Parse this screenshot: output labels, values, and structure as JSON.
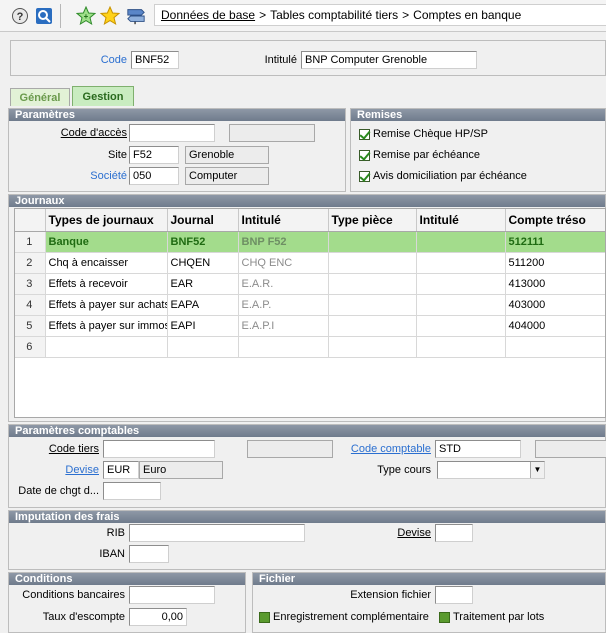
{
  "toolbar": {
    "icons": [
      "help-icon",
      "search-icon",
      "favorite-add-icon",
      "favorite-star-icon",
      "signpost-icon"
    ]
  },
  "breadcrumb": {
    "items": [
      "Données de base",
      "Tables comptabilité tiers",
      "Comptes en banque"
    ]
  },
  "header": {
    "code_label": "Code",
    "code_value": "BNF52",
    "intitule_label": "Intitulé",
    "intitule_value": "BNP Computer Grenoble"
  },
  "tabs": [
    {
      "label": "Général",
      "active": false
    },
    {
      "label": "Gestion",
      "active": true
    }
  ],
  "parametres": {
    "title": "Paramètres",
    "code_acces_label": "Code d'accès",
    "code_acces_value": "",
    "code_acces_extra": "",
    "site_label": "Site",
    "site_code": "F52",
    "site_name": "Grenoble",
    "societe_label": "Société",
    "societe_code": "050",
    "societe_name": "Computer"
  },
  "remises": {
    "title": "Remises",
    "items": [
      {
        "label": "Remise Chèque HP/SP",
        "checked": true
      },
      {
        "label": "Remise par échéance",
        "checked": true
      },
      {
        "label": "Avis domiciliation par échéance",
        "checked": true
      }
    ]
  },
  "journaux": {
    "title": "Journaux",
    "columns": [
      "Types de journaux",
      "Journal",
      "Intitulé",
      "Type pièce",
      "Intitulé",
      "Compte tréso"
    ],
    "rows": [
      {
        "idx": "1",
        "type": "Banque",
        "journal": "BNF52",
        "intitule": "BNP F52",
        "type_piece": "",
        "intitule2": "",
        "compte": "512111"
      },
      {
        "idx": "2",
        "type": "Chq à encaisser",
        "journal": "CHQEN",
        "intitule": "CHQ ENC",
        "type_piece": "",
        "intitule2": "",
        "compte": "511200"
      },
      {
        "idx": "3",
        "type": "Effets à recevoir",
        "journal": "EAR",
        "intitule": "E.A.R.",
        "type_piece": "",
        "intitule2": "",
        "compte": "413000"
      },
      {
        "idx": "4",
        "type": "Effets à payer sur achats",
        "journal": "EAPA",
        "intitule": "E.A.P.",
        "type_piece": "",
        "intitule2": "",
        "compte": "403000"
      },
      {
        "idx": "5",
        "type": "Effets à payer sur immos",
        "journal": "EAPI",
        "intitule": "E.A.P.I",
        "type_piece": "",
        "intitule2": "",
        "compte": "404000"
      },
      {
        "idx": "6",
        "type": "",
        "journal": "",
        "intitule": "",
        "type_piece": "",
        "intitule2": "",
        "compte": ""
      }
    ]
  },
  "param_comptables": {
    "title": "Paramètres comptables",
    "code_tiers_label": "Code tiers",
    "code_tiers_value": "",
    "code_tiers_extra": "",
    "code_comptable_label": "Code comptable",
    "code_comptable_value": "STD",
    "code_comptable_extra": "",
    "devise_label": "Devise",
    "devise_code": "EUR",
    "devise_name": "Euro",
    "type_cours_label": "Type cours",
    "type_cours_value": "",
    "date_chgt_label": "Date de chgt d...",
    "date_chgt_value": ""
  },
  "imputation": {
    "title": "Imputation des frais",
    "rib_label": "RIB",
    "rib_value": "",
    "devise_label": "Devise",
    "devise_value": "",
    "iban_label": "IBAN",
    "iban_value": ""
  },
  "conditions": {
    "title": "Conditions",
    "cond_bancaires_label": "Conditions bancaires",
    "cond_bancaires_value": "",
    "taux_escompte_label": "Taux d'escompte",
    "taux_escompte_value": "0,00"
  },
  "fichier": {
    "title": "Fichier",
    "extension_label": "Extension fichier",
    "extension_value": "",
    "enreg_label": "Enregistrement complémentaire",
    "traitement_label": "Traitement par lots"
  },
  "colors": {
    "selected_row": "#a3dc8c",
    "group_header": "#7b8696",
    "link_blue": "#2b6fd0"
  }
}
